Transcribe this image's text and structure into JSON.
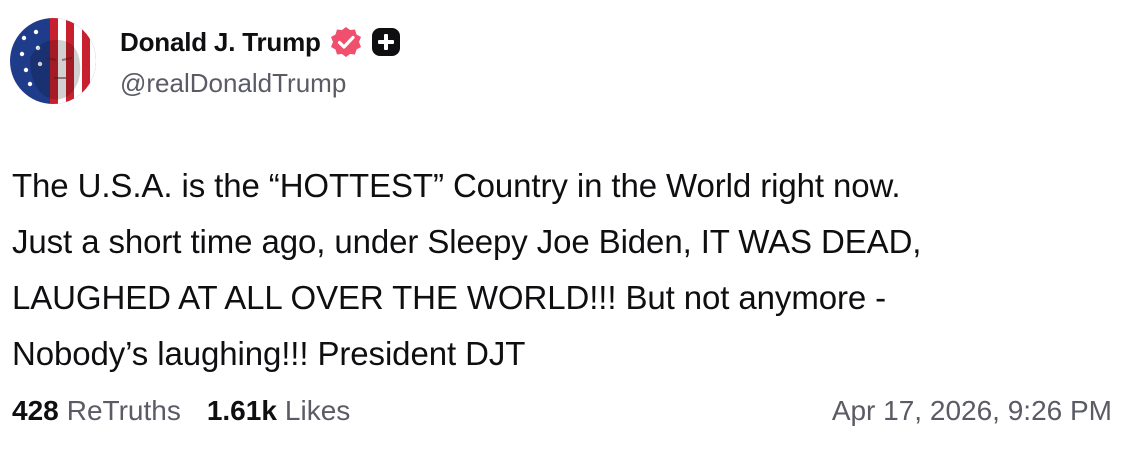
{
  "post": {
    "author": {
      "display_name": "Donald J. Trump",
      "handle": "@realDonaldTrump",
      "verified_icon": "verified-badge-icon",
      "subscription_icon": "truth-plus-icon",
      "verified_color": "#f0506e",
      "subscription_color": "#0f0f12"
    },
    "text": "The U.S.A. is the “HOTTEST” Country in the World right now.\nJust a short time ago, under Sleepy Joe Biden, IT WAS DEAD,\nLAUGHED AT ALL OVER THE WORLD!!! But not anymore -\nNobody’s laughing!!! President DJT",
    "stats": {
      "retruths_count": "428",
      "retruths_label": "ReTruths",
      "likes_count": "1.61k",
      "likes_label": "Likes"
    },
    "timestamp": "Apr 17, 2026, 9:26 PM"
  }
}
